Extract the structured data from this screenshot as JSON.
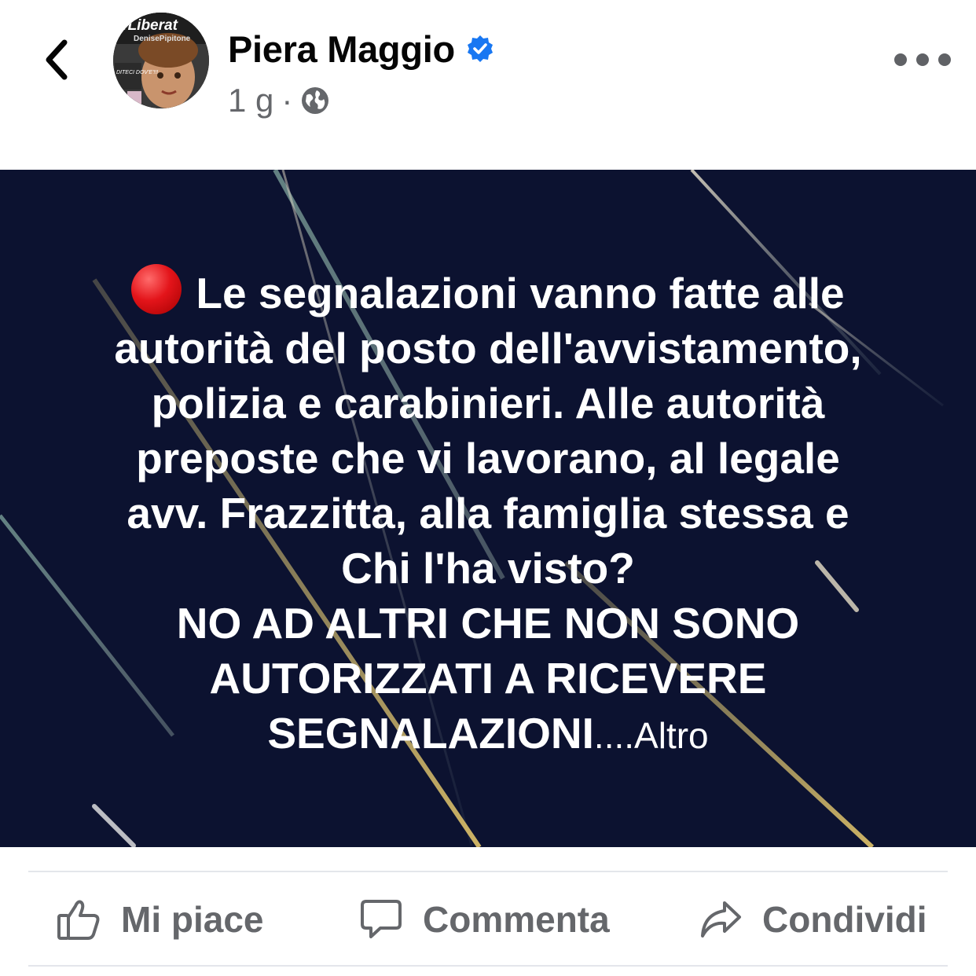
{
  "header": {
    "author_name": "Piera Maggio",
    "verified": true,
    "time_ago": "1 g",
    "separator": "·",
    "privacy_icon": "globe-icon",
    "avatar_text_top": "#Liberat",
    "avatar_text_sub": "DenisePipitone",
    "avatar_text_side": "DITECI DOV'E'!!!"
  },
  "post": {
    "lines": [
      "Le segnalazioni vanno fatte alle",
      "autorità del posto dell'avvistamento,",
      "polizia e carabinieri. Alle autorità",
      "preposte che vi lavorano, al legale",
      "avv. Frazzitta, alla famiglia stessa e",
      "Chi l'ha visto?"
    ],
    "upper_lines": [
      "NO AD ALTRI CHE NON SONO",
      "AUTORIZZATI A RICEVERE",
      "SEGNALAZIONI"
    ],
    "ellipsis": "....",
    "more_label": "Altro",
    "background_color": "#0c1230"
  },
  "actions": {
    "like_label": "Mi piace",
    "comment_label": "Commenta",
    "share_label": "Condividi"
  },
  "colors": {
    "secondary_text": "#65676b",
    "verified_blue": "#1877f2"
  }
}
